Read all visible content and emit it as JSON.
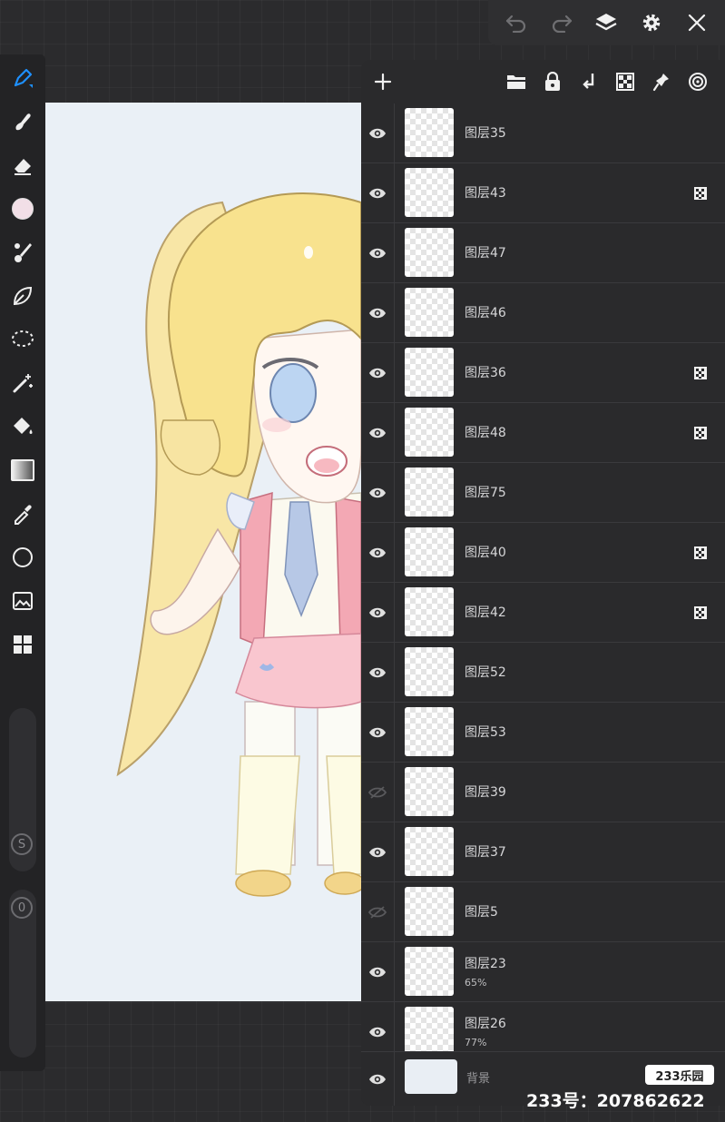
{
  "topbar": {
    "icons": [
      "undo-icon",
      "redo-icon",
      "layers-icon",
      "settings-icon",
      "close-icon"
    ]
  },
  "toolbar": {
    "tools": [
      "pen-icon",
      "smudge-icon",
      "eraser-icon",
      "color-swatch",
      "brush-icon",
      "leaf-icon",
      "lasso-icon",
      "magic-wand-icon",
      "bucket-icon",
      "gradient-icon",
      "eyedropper-icon",
      "shape-circle-icon",
      "image-icon",
      "grid-icon"
    ],
    "size_badge": "S",
    "opacity_badge": "0"
  },
  "layer_panel": {
    "header_icons": [
      "add-icon",
      "folder-icon",
      "lock-icon",
      "merge-down-icon",
      "alpha-lock-icon",
      "pin-icon",
      "target-icon"
    ],
    "layers": [
      {
        "name": "图层35",
        "visible": true,
        "opacity": "",
        "alpha_lock": false
      },
      {
        "name": "图层43",
        "visible": true,
        "opacity": "",
        "alpha_lock": true
      },
      {
        "name": "图层47",
        "visible": true,
        "opacity": "",
        "alpha_lock": false
      },
      {
        "name": "图层46",
        "visible": true,
        "opacity": "",
        "alpha_lock": false
      },
      {
        "name": "图层36",
        "visible": true,
        "opacity": "",
        "alpha_lock": true
      },
      {
        "name": "图层48",
        "visible": true,
        "opacity": "",
        "alpha_lock": true
      },
      {
        "name": "图层75",
        "visible": true,
        "opacity": "",
        "alpha_lock": false
      },
      {
        "name": "图层40",
        "visible": true,
        "opacity": "",
        "alpha_lock": true
      },
      {
        "name": "图层42",
        "visible": true,
        "opacity": "",
        "alpha_lock": true
      },
      {
        "name": "图层52",
        "visible": true,
        "opacity": "",
        "alpha_lock": false
      },
      {
        "name": "图层53",
        "visible": true,
        "opacity": "",
        "alpha_lock": false
      },
      {
        "name": "图层39",
        "visible": false,
        "opacity": "",
        "alpha_lock": false
      },
      {
        "name": "图层37",
        "visible": true,
        "opacity": "",
        "alpha_lock": false
      },
      {
        "name": "图层5",
        "visible": false,
        "opacity": "",
        "alpha_lock": false
      },
      {
        "name": "图层23",
        "visible": true,
        "opacity": "65%",
        "alpha_lock": false
      },
      {
        "name": "图层26",
        "visible": true,
        "opacity": "77%",
        "alpha_lock": false
      }
    ],
    "background_label": "背景"
  },
  "watermark": {
    "logo": "233乐园",
    "id": "233号：207862622"
  },
  "colors": {
    "accent": "#1e90ff",
    "canvas": "#eaf0f6",
    "panel": "#2a2a2c"
  }
}
